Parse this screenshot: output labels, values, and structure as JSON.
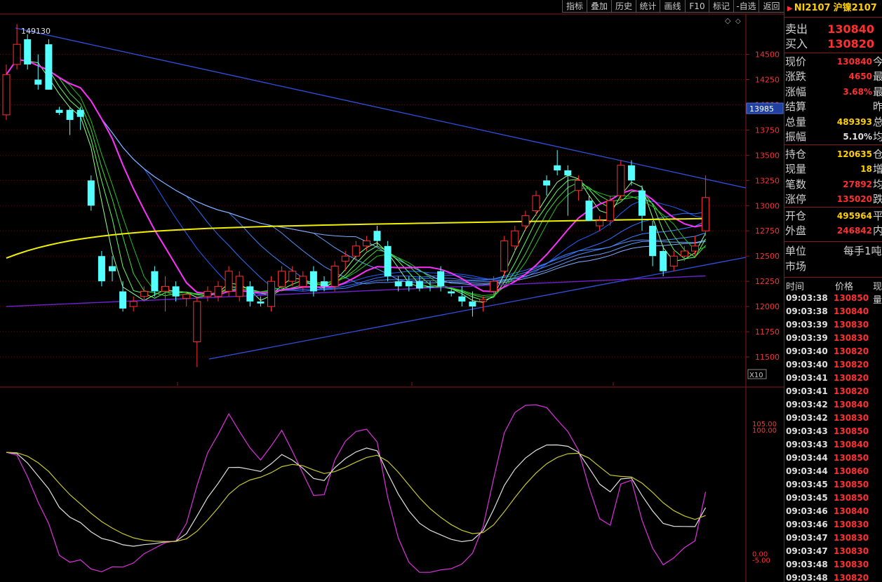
{
  "toolbar": {
    "buttons": [
      {
        "label": "指标",
        "name": "indicator-button"
      },
      {
        "label": "叠加",
        "name": "overlay-button"
      },
      {
        "label": "历史",
        "name": "history-button"
      },
      {
        "label": "统计",
        "name": "statistics-button"
      },
      {
        "label": "画线",
        "name": "draw-line-button"
      },
      {
        "label": "F10",
        "name": "f10-button"
      },
      {
        "label": "标记",
        "name": "mark-button"
      },
      {
        "label": "-自选",
        "name": "remove-watchlist-button"
      },
      {
        "label": "返回",
        "name": "back-button"
      }
    ]
  },
  "chart": {
    "peak_label": "149130",
    "current_price_tag": "13985",
    "x10_label": "X10",
    "price_axis": [
      "14500",
      "14250",
      "14000",
      "13750",
      "13500",
      "13250",
      "13000",
      "12750",
      "12500",
      "12250",
      "12000",
      "11750",
      "11500"
    ],
    "osc_axis": {
      "top1": "105.00",
      "top2": "100.00",
      "bot1": "0.00",
      "bot2": "-5.00"
    }
  },
  "chart_data": {
    "type": "candlestick",
    "ylim": [
      11250,
      14900
    ],
    "y_ticks": [
      14500,
      14250,
      14000,
      13750,
      13500,
      13250,
      13000,
      12750,
      12500,
      12250,
      12000,
      11750,
      11500
    ],
    "candles": [
      {
        "o": 13900,
        "h": 14400,
        "l": 13850,
        "c": 14300,
        "color": "red"
      },
      {
        "o": 14400,
        "h": 14800,
        "l": 14350,
        "c": 14600,
        "color": "red"
      },
      {
        "o": 14650,
        "h": 14700,
        "l": 14350,
        "c": 14400,
        "color": "cyan"
      },
      {
        "o": 14200,
        "h": 14500,
        "l": 14150,
        "c": 14250,
        "color": "cyan"
      },
      {
        "o": 14600,
        "h": 14650,
        "l": 14150,
        "c": 14150,
        "color": "cyan"
      },
      {
        "o": 13950,
        "h": 13980,
        "l": 13900,
        "c": 13920,
        "color": "cyan"
      },
      {
        "o": 13950,
        "h": 13980,
        "l": 13700,
        "c": 13850,
        "color": "cyan"
      },
      {
        "o": 13950,
        "h": 13980,
        "l": 13750,
        "c": 13880,
        "color": "cyan"
      },
      {
        "o": 13250,
        "h": 13300,
        "l": 12950,
        "c": 13000,
        "color": "cyan"
      },
      {
        "o": 12500,
        "h": 12550,
        "l": 12200,
        "c": 12250,
        "color": "cyan"
      },
      {
        "o": 12400,
        "h": 12500,
        "l": 12250,
        "c": 12350,
        "color": "cyan"
      },
      {
        "o": 12150,
        "h": 12250,
        "l": 11950,
        "c": 11980,
        "color": "cyan"
      },
      {
        "o": 12000,
        "h": 12100,
        "l": 11950,
        "c": 12050,
        "color": "red"
      },
      {
        "o": 12100,
        "h": 12200,
        "l": 12050,
        "c": 12150,
        "color": "red"
      },
      {
        "o": 12350,
        "h": 12400,
        "l": 12100,
        "c": 12150,
        "color": "cyan"
      },
      {
        "o": 12150,
        "h": 12300,
        "l": 11950,
        "c": 12200,
        "color": "red"
      },
      {
        "o": 12200,
        "h": 12250,
        "l": 12050,
        "c": 12100,
        "color": "cyan"
      },
      {
        "o": 12080,
        "h": 12150,
        "l": 12000,
        "c": 12120,
        "color": "red"
      },
      {
        "o": 11650,
        "h": 12100,
        "l": 11400,
        "c": 12050,
        "color": "red"
      },
      {
        "o": 12100,
        "h": 12200,
        "l": 12050,
        "c": 12150,
        "color": "red"
      },
      {
        "o": 12100,
        "h": 12250,
        "l": 12050,
        "c": 12200,
        "color": "red"
      },
      {
        "o": 12150,
        "h": 12400,
        "l": 12100,
        "c": 12350,
        "color": "red"
      },
      {
        "o": 12300,
        "h": 12350,
        "l": 12050,
        "c": 12100,
        "color": "red"
      },
      {
        "o": 12200,
        "h": 12250,
        "l": 12000,
        "c": 12050,
        "color": "cyan"
      },
      {
        "o": 12050,
        "h": 12100,
        "l": 12000,
        "c": 12030,
        "color": "cyan"
      },
      {
        "o": 12000,
        "h": 12300,
        "l": 11950,
        "c": 12250,
        "color": "red"
      },
      {
        "o": 12200,
        "h": 12400,
        "l": 12150,
        "c": 12350,
        "color": "red"
      },
      {
        "o": 12350,
        "h": 12400,
        "l": 12200,
        "c": 12250,
        "color": "red"
      },
      {
        "o": 12300,
        "h": 12350,
        "l": 12150,
        "c": 12200,
        "color": "red"
      },
      {
        "o": 12350,
        "h": 12400,
        "l": 12100,
        "c": 12150,
        "color": "cyan"
      },
      {
        "o": 12250,
        "h": 12300,
        "l": 12150,
        "c": 12200,
        "color": "cyan"
      },
      {
        "o": 12200,
        "h": 12450,
        "l": 12150,
        "c": 12400,
        "color": "red"
      },
      {
        "o": 12450,
        "h": 12550,
        "l": 12350,
        "c": 12500,
        "color": "red"
      },
      {
        "o": 12500,
        "h": 12650,
        "l": 12450,
        "c": 12600,
        "color": "red"
      },
      {
        "o": 12600,
        "h": 12700,
        "l": 12550,
        "c": 12650,
        "color": "red"
      },
      {
        "o": 12750,
        "h": 12800,
        "l": 12600,
        "c": 12650,
        "color": "cyan"
      },
      {
        "o": 12600,
        "h": 12650,
        "l": 12250,
        "c": 12300,
        "color": "cyan"
      },
      {
        "o": 12250,
        "h": 12300,
        "l": 12150,
        "c": 12200,
        "color": "cyan"
      },
      {
        "o": 12250,
        "h": 12300,
        "l": 12150,
        "c": 12200,
        "color": "cyan"
      },
      {
        "o": 12250,
        "h": 12300,
        "l": 12150,
        "c": 12180,
        "color": "cyan"
      },
      {
        "o": 12200,
        "h": 12250,
        "l": 12150,
        "c": 12200,
        "color": "cyan"
      },
      {
        "o": 12350,
        "h": 12400,
        "l": 12150,
        "c": 12200,
        "color": "cyan"
      },
      {
        "o": 12150,
        "h": 12180,
        "l": 12100,
        "c": 12130,
        "color": "cyan"
      },
      {
        "o": 12100,
        "h": 12200,
        "l": 12000,
        "c": 12050,
        "color": "cyan"
      },
      {
        "o": 12050,
        "h": 12150,
        "l": 11900,
        "c": 12000,
        "color": "cyan"
      },
      {
        "o": 12050,
        "h": 12100,
        "l": 11950,
        "c": 12070,
        "color": "red"
      },
      {
        "o": 12150,
        "h": 12300,
        "l": 12100,
        "c": 12250,
        "color": "red"
      },
      {
        "o": 12350,
        "h": 12700,
        "l": 12300,
        "c": 12650,
        "color": "red"
      },
      {
        "o": 12600,
        "h": 12800,
        "l": 12550,
        "c": 12750,
        "color": "red"
      },
      {
        "o": 12800,
        "h": 12950,
        "l": 12750,
        "c": 12900,
        "color": "red"
      },
      {
        "o": 12950,
        "h": 13150,
        "l": 12900,
        "c": 13100,
        "color": "red"
      },
      {
        "o": 13200,
        "h": 13300,
        "l": 13100,
        "c": 13250,
        "color": "cyan"
      },
      {
        "o": 13400,
        "h": 13550,
        "l": 13300,
        "c": 13350,
        "color": "cyan"
      },
      {
        "o": 13350,
        "h": 13400,
        "l": 12900,
        "c": 13300,
        "color": "cyan"
      },
      {
        "o": 13250,
        "h": 13300,
        "l": 13050,
        "c": 13150,
        "color": "red"
      },
      {
        "o": 13050,
        "h": 13100,
        "l": 12850,
        "c": 12850,
        "color": "cyan"
      },
      {
        "o": 12800,
        "h": 12900,
        "l": 12750,
        "c": 12850,
        "color": "red"
      },
      {
        "o": 12850,
        "h": 13100,
        "l": 12800,
        "c": 13050,
        "color": "red"
      },
      {
        "o": 13100,
        "h": 13450,
        "l": 13050,
        "c": 13400,
        "color": "red"
      },
      {
        "o": 13400,
        "h": 13450,
        "l": 13200,
        "c": 13250,
        "color": "cyan"
      },
      {
        "o": 13150,
        "h": 13200,
        "l": 12750,
        "c": 12900,
        "color": "cyan"
      },
      {
        "o": 12800,
        "h": 12850,
        "l": 12400,
        "c": 12500,
        "color": "cyan"
      },
      {
        "o": 12550,
        "h": 12600,
        "l": 12300,
        "c": 12350,
        "color": "cyan"
      },
      {
        "o": 12400,
        "h": 12550,
        "l": 12350,
        "c": 12500,
        "color": "red"
      },
      {
        "o": 12500,
        "h": 12600,
        "l": 12450,
        "c": 12550,
        "color": "red"
      },
      {
        "o": 12600,
        "h": 12700,
        "l": 12500,
        "c": 12550,
        "color": "red"
      },
      {
        "o": 12750,
        "h": 13300,
        "l": 12700,
        "c": 13080,
        "color": "red"
      }
    ],
    "osc_ylim": [
      -20,
      130
    ]
  },
  "quote": {
    "title": {
      "code": "NI2107",
      "name": "沪镍2107"
    },
    "sell": {
      "label": "卖出",
      "value": "130840"
    },
    "buy": {
      "label": "买入",
      "value": "130820"
    },
    "rows": [
      {
        "label": "现价",
        "value": "130840",
        "color": "red",
        "label2": "今开"
      },
      {
        "label": "涨跌",
        "value": "4650",
        "color": "red",
        "label2": "最高"
      },
      {
        "label": "涨幅",
        "value": "3.68%",
        "color": "red",
        "label2": "最低"
      },
      {
        "label": "结算",
        "value": "",
        "color": "red",
        "label2": "昨结"
      },
      {
        "label": "总量",
        "value": "489393",
        "color": "yel",
        "label2": "总额"
      },
      {
        "label": "振幅",
        "value": "5.10%",
        "color": "wht",
        "label2": "均价"
      }
    ],
    "rows2": [
      {
        "label": "持仓",
        "value": "120635",
        "color": "yel",
        "label2": "仓差"
      },
      {
        "label": "现量",
        "value": "18",
        "color": "yel",
        "label2": "增仓"
      },
      {
        "label": "笔数",
        "value": "27892",
        "color": "red",
        "label2": "均笔"
      },
      {
        "label": "涨停",
        "value": "135020",
        "color": "red",
        "label2": "跌停"
      }
    ],
    "rows3": [
      {
        "label": "开仓",
        "value": "495964",
        "color": "yel",
        "label2": "平仓"
      },
      {
        "label": "外盘",
        "value": "246842",
        "color": "red",
        "label2": "内盘"
      }
    ],
    "unit": {
      "label": "单位",
      "value": "每手1吨"
    },
    "market": {
      "label": "市场"
    },
    "ticks_header": {
      "time": "时间",
      "price": "价格",
      "vol": "现量"
    },
    "ticks": [
      {
        "time": "09:03:38",
        "price": "130850"
      },
      {
        "time": "09:03:38",
        "price": "130840"
      },
      {
        "time": "09:03:39",
        "price": "130830"
      },
      {
        "time": "09:03:39",
        "price": "130830"
      },
      {
        "time": "09:03:40",
        "price": "130820"
      },
      {
        "time": "09:03:40",
        "price": "130820"
      },
      {
        "time": "09:03:41",
        "price": "130820"
      },
      {
        "time": "09:03:41",
        "price": "130820"
      },
      {
        "time": "09:03:42",
        "price": "130840"
      },
      {
        "time": "09:03:42",
        "price": "130830"
      },
      {
        "time": "09:03:43",
        "price": "130850"
      },
      {
        "time": "09:03:43",
        "price": "130840"
      },
      {
        "time": "09:03:44",
        "price": "130850"
      },
      {
        "time": "09:03:44",
        "price": "130860"
      },
      {
        "time": "09:03:45",
        "price": "130850"
      },
      {
        "time": "09:03:45",
        "price": "130850"
      },
      {
        "time": "09:03:46",
        "price": "130840"
      },
      {
        "time": "09:03:46",
        "price": "130830"
      },
      {
        "time": "09:03:47",
        "price": "130830"
      },
      {
        "time": "09:03:47",
        "price": "130830"
      },
      {
        "time": "09:03:48",
        "price": "130830"
      },
      {
        "time": "09:03:48",
        "price": "130820"
      }
    ]
  },
  "colors": {
    "candle_up": "#ff3030",
    "candle_down": "#54ffff",
    "trend_line": "#3050e0",
    "ma_yellow": "#f0f000",
    "ma_magenta": "#ff30ff",
    "ma_green": "#40ff40",
    "ma_blue": "#4070ff",
    "ma_purple": "#7020d0",
    "osc_magenta": "#e030e0",
    "osc_white": "#e0e0e0",
    "osc_yellow": "#c8c830"
  }
}
